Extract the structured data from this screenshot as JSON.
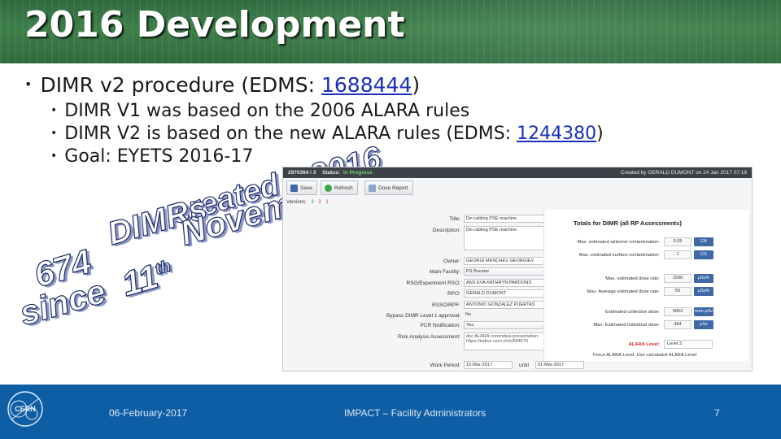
{
  "slide": {
    "title": "2016 Development",
    "bullet1": {
      "text": "DIMR v2 procedure (EDMS: ",
      "link": "1688444",
      "suffix": ")"
    },
    "subbullets": [
      {
        "text": "DIMR V1 was based on the 2006 ALARA rules"
      },
      {
        "text": "DIMR V2 is based on the new ALARA rules (EDMS: ",
        "link": "1244380",
        "suffix": ")"
      },
      {
        "text": "Goal: EYETS 2016-17"
      }
    ],
    "stamp": {
      "line1": "created",
      "line2a": "DIMRs",
      "line2b": "2016",
      "line3a": "674",
      "line3b": "November",
      "line4a": "since",
      "line4b": "11",
      "line4sup": "th"
    }
  },
  "app": {
    "top_id": "2970364 / 3",
    "status_label": "Status:",
    "status_value": "In Progress",
    "created_by": "Created by GERALD DUMONT on 24 Jan 2017 07:19",
    "toolbar": {
      "save": "Save",
      "refresh": "Refresh",
      "dose_report": "Dose Report"
    },
    "versions_label": "Versions:",
    "versions": [
      "3",
      "2",
      "1"
    ],
    "form": [
      {
        "label": "Title:",
        "value": "De-cabling PSE machine"
      },
      {
        "label": "Description:",
        "value": "De-cabling PSE machine"
      },
      {
        "label": "Owner:",
        "value": "GEORGI MENCHEV GEORGIEV"
      },
      {
        "label": "Main Facility:",
        "value": "PS Booster"
      },
      {
        "label": "RSO/Experiment RSO:",
        "value": "ANS EVA KATHRYN PARDONS"
      },
      {
        "label": "RPO:",
        "value": "GERALD DUMONT"
      },
      {
        "label": "RSSO/RPF:",
        "value": "ANTONIO GONZALEZ PUERTAS"
      },
      {
        "label": "Bypass DIMR Level 1 approval:",
        "value": "No"
      },
      {
        "label": "PCR Notification:",
        "value": "Yes"
      },
      {
        "label": "Risk Analysis Assessment:",
        "value": "doc ALARA committee presentation: https://indico.cern.ch/e/594575"
      },
      {
        "label": "Work Period:",
        "value": "15-Mar-2017",
        "until": "until",
        "value2": "01-Mar-2017"
      }
    ],
    "panel": {
      "title": "Totals for DIMR (all RP Assessments)",
      "rows": [
        {
          "label": "Max. estimated airborne contamination:",
          "value": "0.05",
          "unit": "CA"
        },
        {
          "label": "Max. estimated surface contamination:",
          "value": "1",
          "unit": "CS"
        },
        {
          "label": "Max. estimated dose rate:",
          "value": "1500",
          "unit": "µSv/h"
        },
        {
          "label": "Max. Average estimated dose rate:",
          "value": "50",
          "unit": "µSv/h"
        },
        {
          "label": "Estimated collective dose:",
          "value": "5852",
          "unit": "men.µSv"
        },
        {
          "label": "Max. Estimated individual dose:",
          "value": "364",
          "unit": "µSv"
        }
      ],
      "alara_label": "ALARA Level:",
      "alara_value": "Level 3",
      "force_text": "Force ALARA Level: Use calculated ALARA Level"
    }
  },
  "footer": {
    "date": "06-February-2017",
    "center": "IMPACT – Facility Administrators",
    "page": "7",
    "logo_text": "CERN"
  },
  "colors": {
    "title_bg": "#3e7f4a",
    "footer_bg": "#0e5ea6",
    "link": "#1a2fb8",
    "unit_bg": "#3e69a6",
    "alara_red": "#d3272e"
  }
}
